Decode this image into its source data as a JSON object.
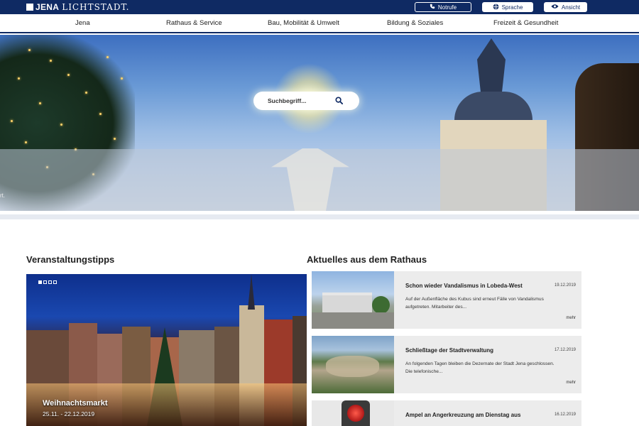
{
  "header": {
    "logo_bold": "JENA",
    "logo_light": "LICHTSTADT.",
    "notrufe": "Notrufe",
    "sprache": "Sprache",
    "ansicht": "Ansicht"
  },
  "nav": [
    "Jena",
    "Rathaus & Service",
    "Bau, Mobilität & Umwelt",
    "Bildung & Soziales",
    "Freizeit & Gesundheit"
  ],
  "hero": {
    "search_placeholder": "Suchbegriff...",
    "caption_fragment": "rt."
  },
  "events": {
    "heading": "Veranstaltungstipps",
    "slides_total": 4,
    "slide_active": 1,
    "title": "Weihnachtsmarkt",
    "date": "25.11. - 22.12.2019"
  },
  "news": {
    "heading": "Aktuelles aus dem Rathaus",
    "more_label": "mehr",
    "items": [
      {
        "title": "Schon wieder Vandalismus in Lobeda-West",
        "date": "19.12.2019",
        "text": "Auf der Außenfläche des Kubus sind erneut Fälle von Vandalismus aufgetreten. Mitarbeiter des..."
      },
      {
        "title": "Schließtage der Stadtverwaltung",
        "date": "17.12.2019",
        "text": "An folgenden Tagen bleiben die Dezernate der Stadt Jena geschlossen. Die telefonische..."
      },
      {
        "title": "Ampel an Angerkreuzung am Dienstag aus",
        "date": "16.12.2019",
        "text": ""
      }
    ]
  },
  "colors": {
    "brand_navy": "#0f2a63",
    "news_bg": "#ececec"
  }
}
